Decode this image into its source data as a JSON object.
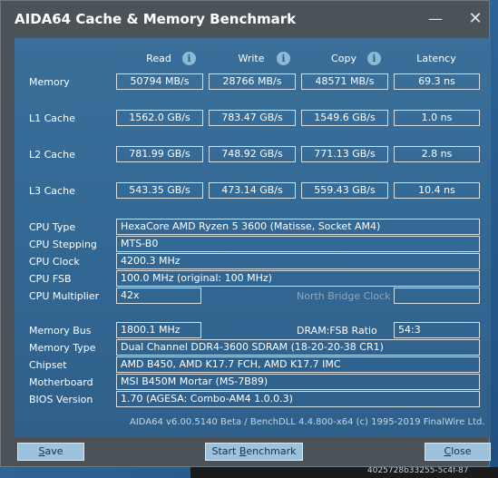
{
  "window": {
    "title": "AIDA64 Cache & Memory Benchmark",
    "minimize_glyph": "—",
    "close_glyph": "✕"
  },
  "columns": {
    "read": "Read",
    "write": "Write",
    "copy": "Copy",
    "latency": "Latency",
    "info_glyph": "i"
  },
  "rows": [
    {
      "label": "Memory",
      "read": "50794 MB/s",
      "write": "28766 MB/s",
      "copy": "48571 MB/s",
      "latency": "69.3 ns"
    },
    {
      "label": "L1 Cache",
      "read": "1562.0 GB/s",
      "write": "783.47 GB/s",
      "copy": "1549.6 GB/s",
      "latency": "1.0 ns"
    },
    {
      "label": "L2 Cache",
      "read": "781.99 GB/s",
      "write": "748.92 GB/s",
      "copy": "771.13 GB/s",
      "latency": "2.8 ns"
    },
    {
      "label": "L3 Cache",
      "read": "543.35 GB/s",
      "write": "473.14 GB/s",
      "copy": "559.43 GB/s",
      "latency": "10.4 ns"
    }
  ],
  "cpu": {
    "type_label": "CPU Type",
    "type": "HexaCore AMD Ryzen 5 3600  (Matisse, Socket AM4)",
    "stepping_label": "CPU Stepping",
    "stepping": "MTS-B0",
    "clock_label": "CPU Clock",
    "clock": "4200.3 MHz",
    "fsb_label": "CPU FSB",
    "fsb": "100.0 MHz  (original: 100 MHz)",
    "multiplier_label": "CPU Multiplier",
    "multiplier": "42x",
    "nb_clock_label": "North Bridge Clock",
    "nb_clock": ""
  },
  "system": {
    "bus_label": "Memory Bus",
    "bus": "1800.1 MHz",
    "ratio_label": "DRAM:FSB Ratio",
    "ratio": "54:3",
    "type_label": "Memory Type",
    "type": "Dual Channel DDR4-3600 SDRAM  (18-20-20-38 CR1)",
    "chipset_label": "Chipset",
    "chipset": "AMD B450, AMD K17.7 FCH, AMD K17.7 IMC",
    "mobo_label": "Motherboard",
    "mobo": "MSI B450M Mortar (MS-7B89)",
    "bios_label": "BIOS Version",
    "bios": "1.70  (AGESA: Combo-AM4 1.0.0.3)"
  },
  "footer": "AIDA64 v6.00.5140 Beta / BenchDLL 4.4.800-x64  (c) 1995-2019 FinalWire Ltd.",
  "buttons": {
    "save_first": "S",
    "save_rest": "ave",
    "start_first": "Start ",
    "start_u": "B",
    "start_rest": "enchmark",
    "close_first": "C",
    "close_rest": "lose"
  },
  "taskbar_fragment": "4025728b33255-5c4f-87"
}
